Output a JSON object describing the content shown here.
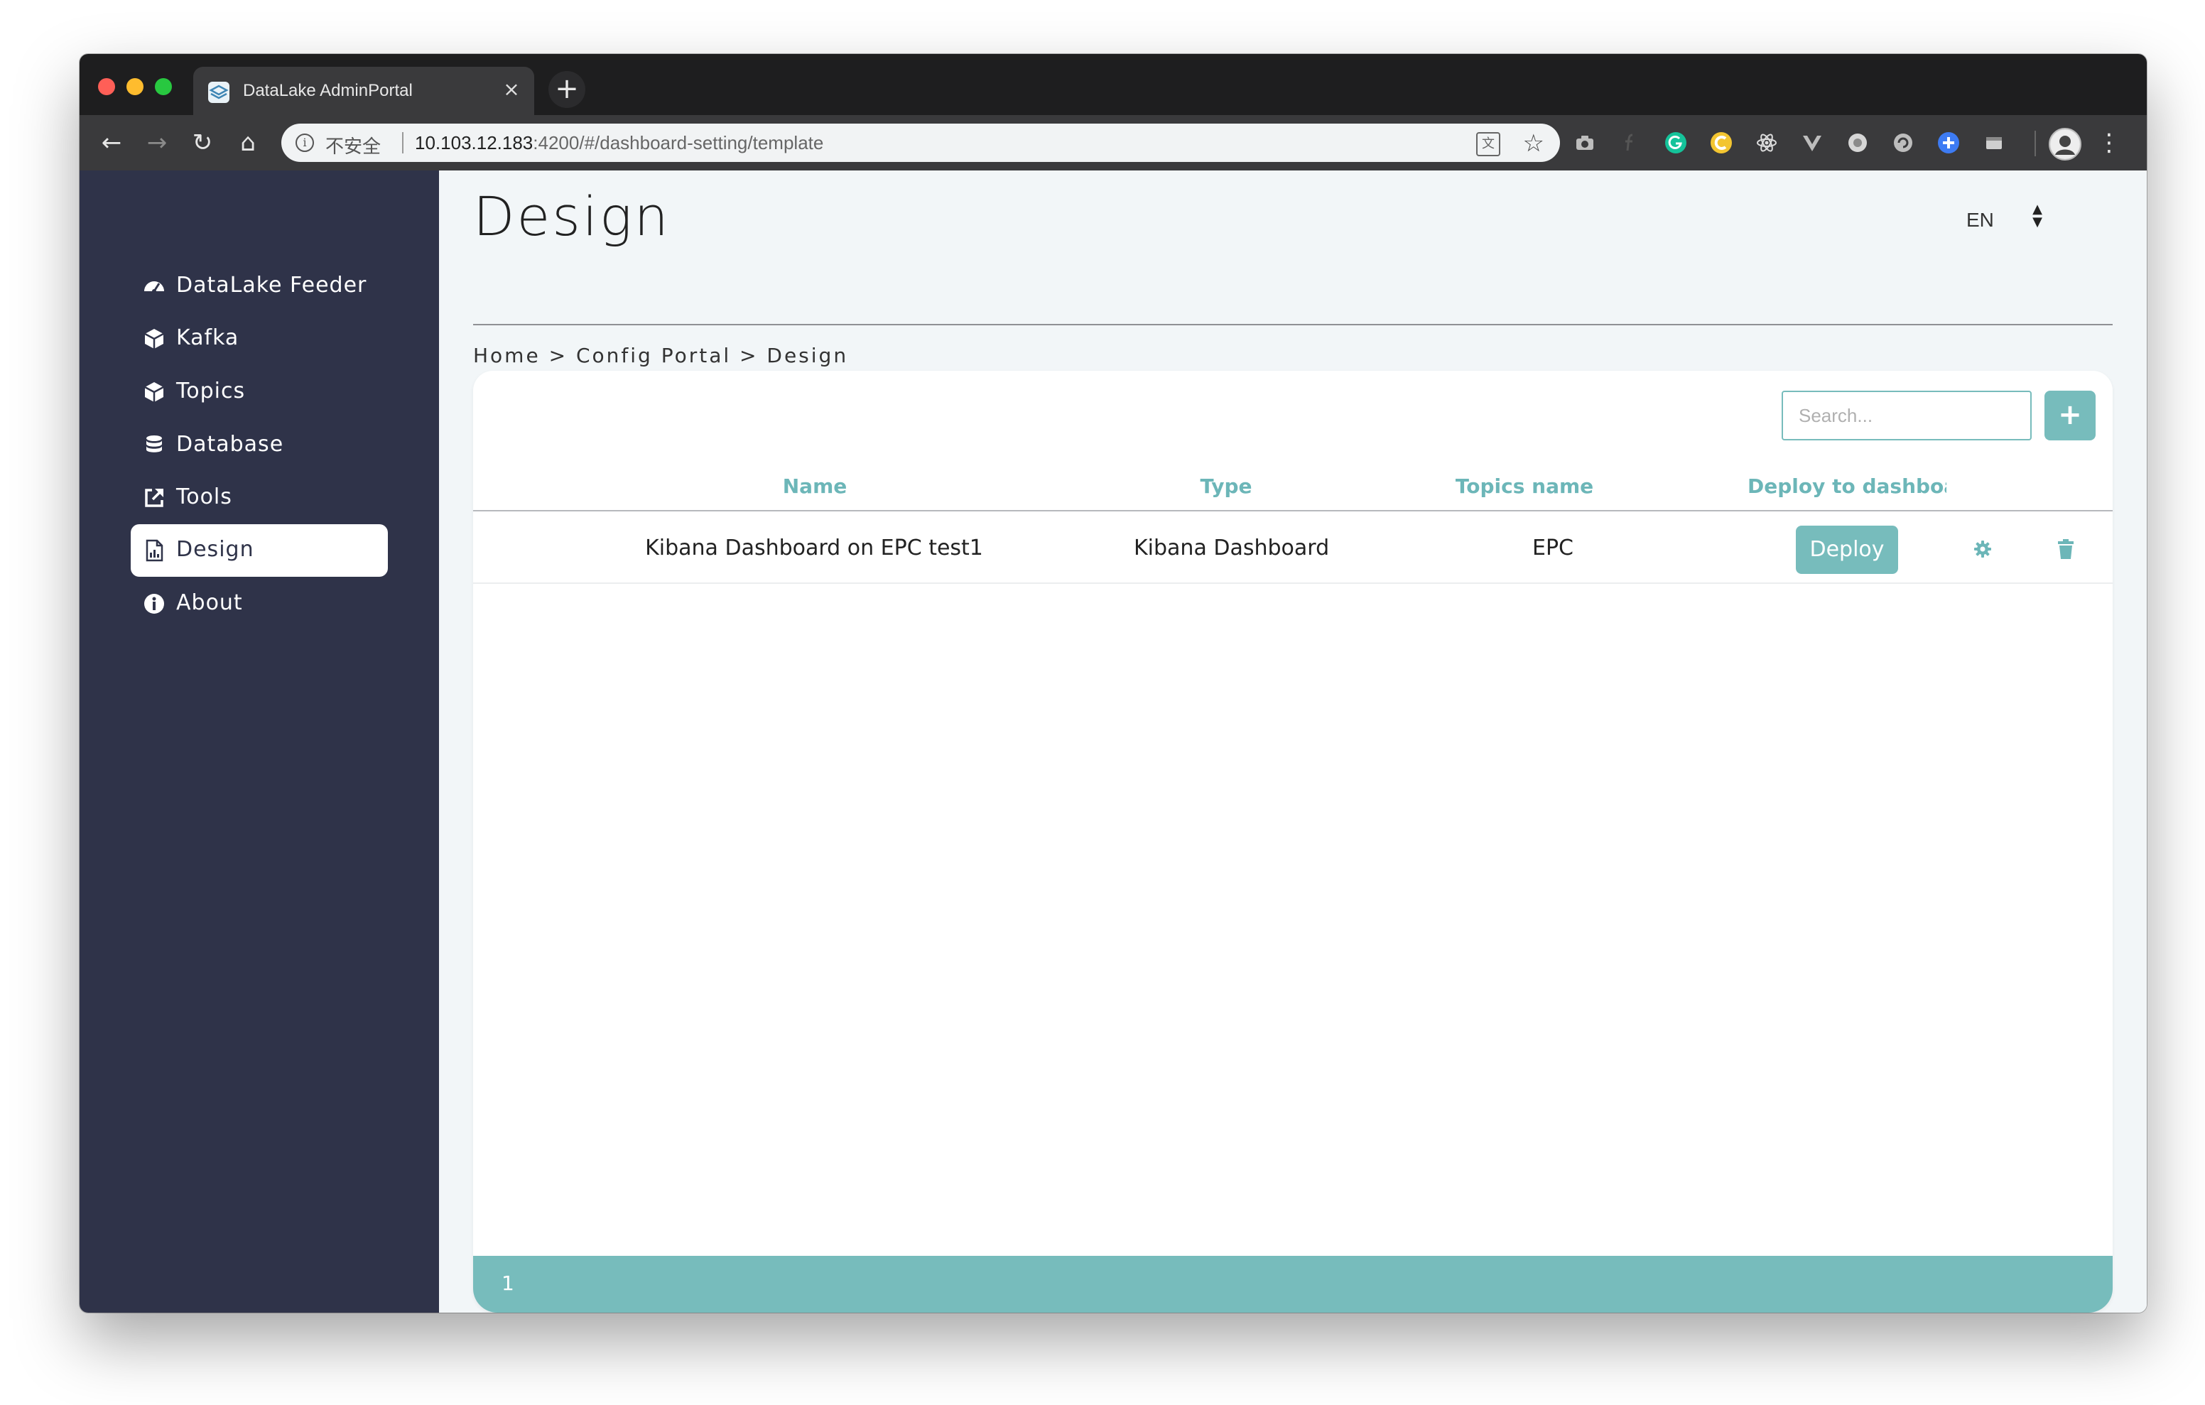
{
  "browser": {
    "tab_title": "DataLake AdminPortal",
    "tab_close": "×",
    "new_tab": "+",
    "security_label": "不安全",
    "url_host": "10.103.12.183",
    "url_rest": ":4200/#/dashboard-setting/template",
    "nav": {
      "back": "←",
      "forward": "→",
      "reload": "↻",
      "home": "⌂"
    },
    "star": "☆",
    "menu": "⋮"
  },
  "sidebar": {
    "items": [
      {
        "label": "DataLake Feeder",
        "icon": "tachometer-icon",
        "active": false
      },
      {
        "label": "Kafka",
        "icon": "cube-icon",
        "active": false
      },
      {
        "label": "Topics",
        "icon": "cube-icon",
        "active": false
      },
      {
        "label": "Database",
        "icon": "database-icon",
        "active": false
      },
      {
        "label": "Tools",
        "icon": "external-link-icon",
        "active": false
      },
      {
        "label": "Design",
        "icon": "file-chart-icon",
        "active": true
      },
      {
        "label": "About",
        "icon": "info-circle-icon",
        "active": false
      }
    ]
  },
  "header": {
    "title": "Design",
    "language": "EN",
    "breadcrumb": "Home > Config Portal > Design"
  },
  "toolbar": {
    "search_placeholder": "Search...",
    "add_label": "+"
  },
  "table": {
    "columns": [
      "Name",
      "Type",
      "Topics name",
      "Deploy to dashboarc"
    ],
    "rows": [
      {
        "name": "Kibana Dashboard on EPC test1",
        "type": "Kibana Dashboard",
        "topics": "EPC",
        "deploy_label": "Deploy"
      }
    ]
  },
  "pagination": {
    "current_page": "1"
  },
  "colors": {
    "sidebar_bg": "#2f3349",
    "accent": "#77bcbc",
    "header_text": "#6cb6b8",
    "page_bg": "#f2f6f8"
  }
}
